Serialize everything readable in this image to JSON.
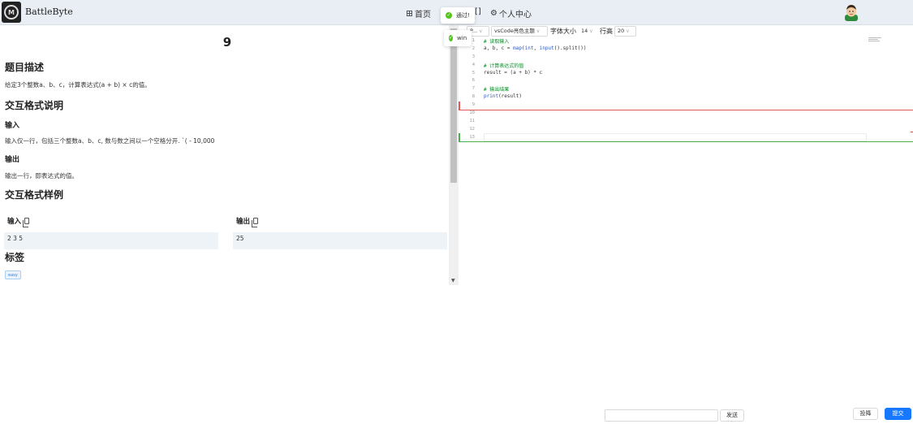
{
  "navbar": {
    "logo_text": "M",
    "brand": "BattleByte",
    "home": "首页",
    "extra": "[]",
    "profile": "个人中心"
  },
  "toasts": [
    {
      "text": "通过!"
    },
    {
      "text": "win"
    }
  ],
  "problem": {
    "title": "9",
    "desc_heading": "题目描述",
    "desc_text": "给定3个整数a、b、c，计算表达式(a + b) × c的值。",
    "io_heading": "交互格式说明",
    "input_heading": "输入",
    "input_text": "输入仅一行，包括三个整数a、b、c, 数与数之间以一个空格分开. `( - 10,000",
    "output_heading": "输出",
    "output_text": "输出一行，即表达式的值。",
    "sample_heading": "交互格式样例",
    "sample_input_label": "输入",
    "sample_output_label": "输出",
    "sample_input": "2 3 5",
    "sample_output": "25",
    "tags_heading": "标签",
    "tags": [
      "easy"
    ]
  },
  "toolbar": {
    "language": "P...",
    "theme": "vsCode亮色主题",
    "font_size_label": "字体大小",
    "font_size": "14",
    "line_height_label": "行高",
    "line_height": "20"
  },
  "editor": {
    "line_numbers": [
      "1",
      "2",
      "3",
      "4",
      "5",
      "6",
      "7",
      "8",
      "9",
      "10",
      "11",
      "12",
      "13"
    ],
    "lines": [
      "# 读取输入",
      "a, b, c = map(int, input().split())",
      "",
      "# 计算表达式的值",
      "result = (a + b) * c",
      "",
      "# 输出结果",
      "print(result)",
      "",
      "",
      "",
      "",
      ""
    ]
  },
  "bottom": {
    "chat_value": "",
    "send": "发送",
    "give_up": "投降",
    "submit": "提交"
  },
  "colors": {
    "accent": "#1677ff",
    "success": "#52c41a",
    "comment": "#0a8a2a",
    "builtin": "#2a55c4",
    "error_line": "#e05a5a",
    "ok_line": "#4caf50"
  }
}
